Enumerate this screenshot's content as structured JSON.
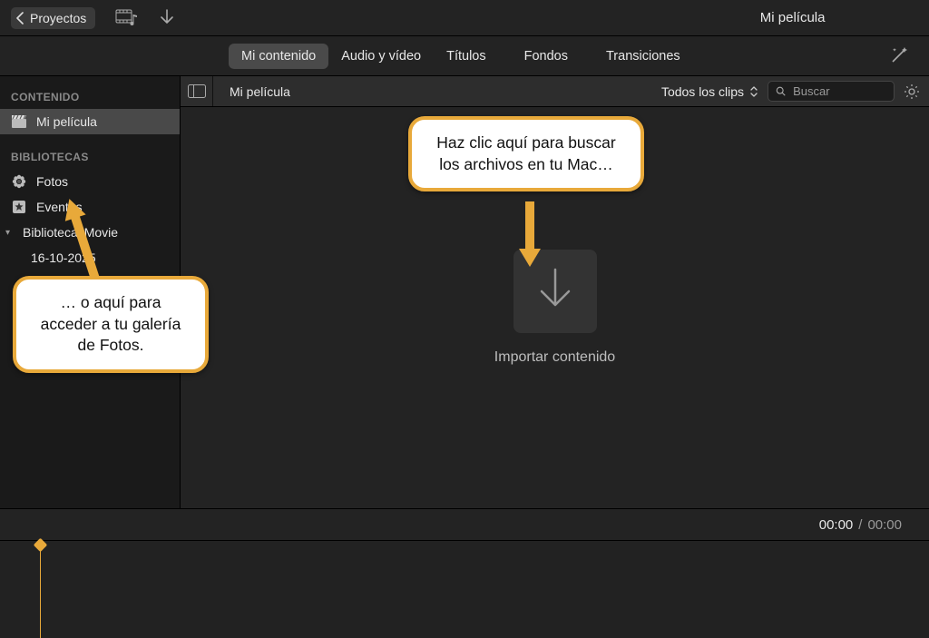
{
  "toolbar": {
    "back_label": "Proyectos",
    "title": "Mi película"
  },
  "tabs": {
    "my_content": "Mi contenido",
    "audio_video": "Audio y vídeo",
    "titles": "Títulos",
    "backgrounds": "Fondos",
    "transitions": "Transiciones"
  },
  "browser": {
    "project": "Mi película",
    "filter": "Todos los clips",
    "search_placeholder": "Buscar"
  },
  "sidebar": {
    "hdr_content": "CONTENIDO",
    "item_movie": "Mi película",
    "hdr_libraries": "BIBLIOTECAS",
    "item_photos": "Fotos",
    "item_events": "Eventos",
    "item_imovie_lib": "Biblioteca iMovie",
    "item_date": "16-10-2025"
  },
  "main": {
    "import_label": "Importar contenido"
  },
  "timeline": {
    "current": "00:00",
    "total": "00:00"
  },
  "callouts": {
    "c1": "Haz clic aquí para buscar los archivos en tu Mac…",
    "c2": "… o aquí para acceder a tu galería de Fotos."
  }
}
